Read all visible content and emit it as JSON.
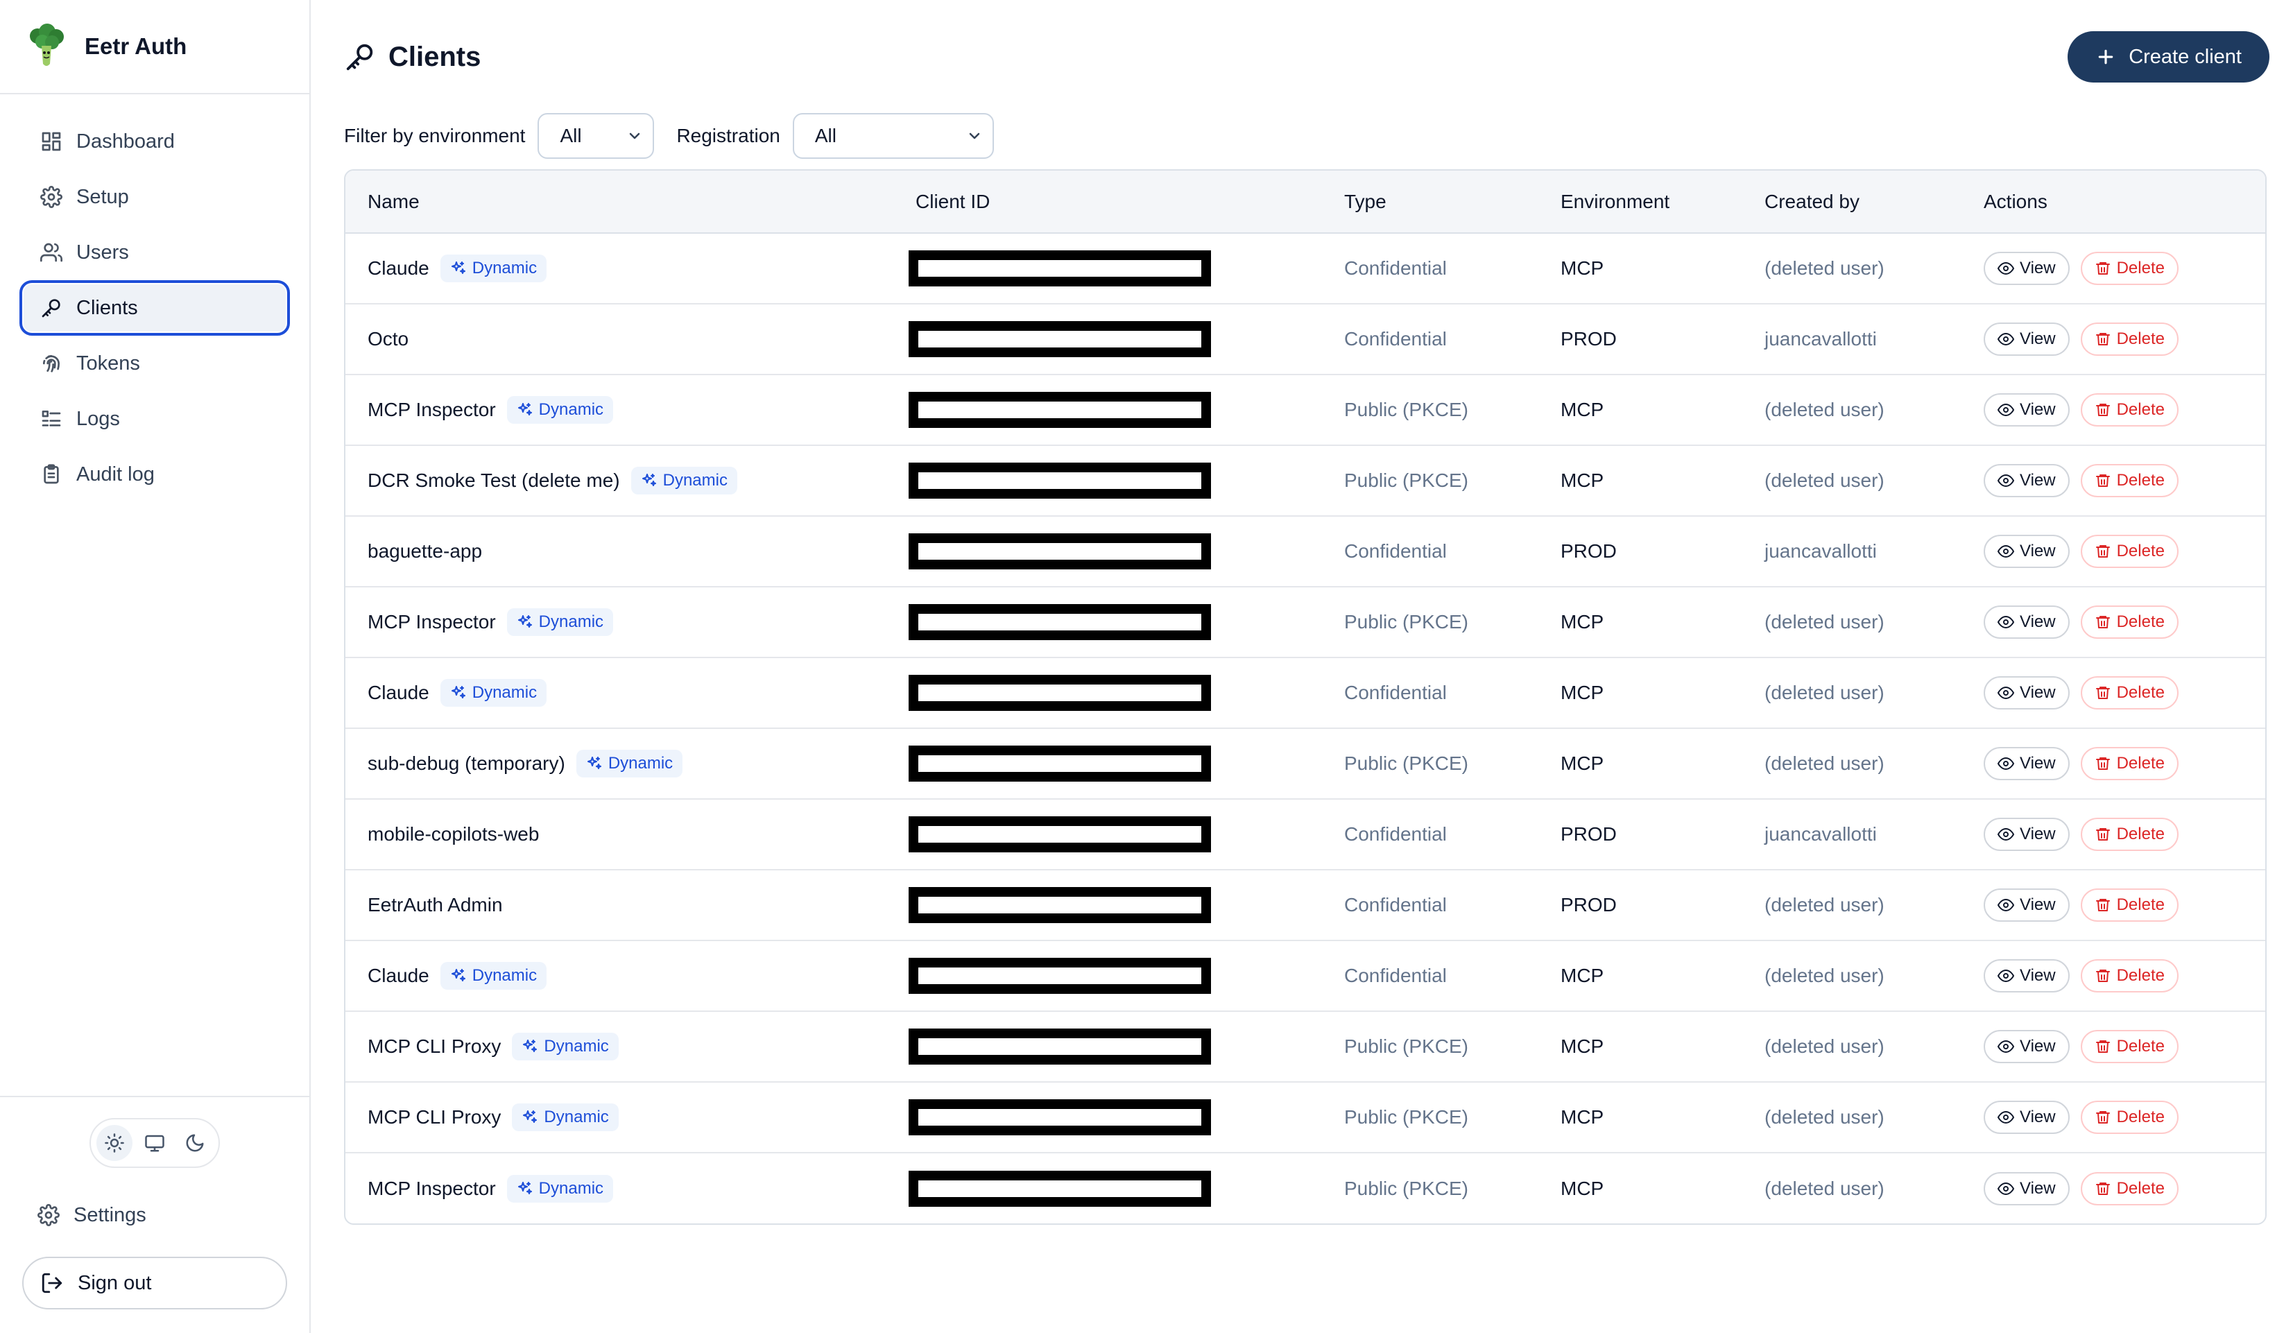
{
  "app": {
    "name": "Eetr Auth"
  },
  "sidebar": {
    "items": [
      {
        "label": "Dashboard",
        "icon": "dashboard-icon",
        "active": false
      },
      {
        "label": "Setup",
        "icon": "gear-icon",
        "active": false
      },
      {
        "label": "Users",
        "icon": "users-icon",
        "active": false
      },
      {
        "label": "Clients",
        "icon": "key-icon",
        "active": true
      },
      {
        "label": "Tokens",
        "icon": "fingerprint-icon",
        "active": false
      },
      {
        "label": "Logs",
        "icon": "list-icon",
        "active": false
      },
      {
        "label": "Audit log",
        "icon": "clipboard-icon",
        "active": false
      }
    ],
    "theme_selected": "light",
    "settings_label": "Settings",
    "signout_label": "Sign out"
  },
  "page": {
    "title": "Clients",
    "create_label": "Create client"
  },
  "filters": {
    "env_label": "Filter by environment",
    "env_value": "All",
    "reg_label": "Registration",
    "reg_value": "All"
  },
  "table": {
    "headers": [
      "Name",
      "Client ID",
      "Type",
      "Environment",
      "Created by",
      "Actions"
    ],
    "badge_label": "Dynamic",
    "view_label": "View",
    "delete_label": "Delete",
    "rows": [
      {
        "name": "Claude",
        "dynamic": true,
        "type": "Confidential",
        "env": "MCP",
        "created_by": "(deleted user)"
      },
      {
        "name": "Octo",
        "dynamic": false,
        "type": "Confidential",
        "env": "PROD",
        "created_by": "juancavallotti"
      },
      {
        "name": "MCP Inspector",
        "dynamic": true,
        "type": "Public (PKCE)",
        "env": "MCP",
        "created_by": "(deleted user)"
      },
      {
        "name": "DCR Smoke Test (delete me)",
        "dynamic": true,
        "type": "Public (PKCE)",
        "env": "MCP",
        "created_by": "(deleted user)"
      },
      {
        "name": "baguette-app",
        "dynamic": false,
        "type": "Confidential",
        "env": "PROD",
        "created_by": "juancavallotti"
      },
      {
        "name": "MCP Inspector",
        "dynamic": true,
        "type": "Public (PKCE)",
        "env": "MCP",
        "created_by": "(deleted user)"
      },
      {
        "name": "Claude",
        "dynamic": true,
        "type": "Confidential",
        "env": "MCP",
        "created_by": "(deleted user)"
      },
      {
        "name": "sub-debug (temporary)",
        "dynamic": true,
        "type": "Public (PKCE)",
        "env": "MCP",
        "created_by": "(deleted user)"
      },
      {
        "name": "mobile-copilots-web",
        "dynamic": false,
        "type": "Confidential",
        "env": "PROD",
        "created_by": "juancavallotti"
      },
      {
        "name": "EetrAuth Admin",
        "dynamic": false,
        "type": "Confidential",
        "env": "PROD",
        "created_by": "(deleted user)"
      },
      {
        "name": "Claude",
        "dynamic": true,
        "type": "Confidential",
        "env": "MCP",
        "created_by": "(deleted user)"
      },
      {
        "name": "MCP CLI Proxy",
        "dynamic": true,
        "type": "Public (PKCE)",
        "env": "MCP",
        "created_by": "(deleted user)"
      },
      {
        "name": "MCP CLI Proxy",
        "dynamic": true,
        "type": "Public (PKCE)",
        "env": "MCP",
        "created_by": "(deleted user)"
      },
      {
        "name": "MCP Inspector",
        "dynamic": true,
        "type": "Public (PKCE)",
        "env": "MCP",
        "created_by": "(deleted user)"
      }
    ]
  },
  "colors": {
    "accent": "#1d4ed8",
    "primary_button": "#1e3a5f",
    "danger": "#dc2626",
    "badge_bg": "#eef4fc"
  }
}
